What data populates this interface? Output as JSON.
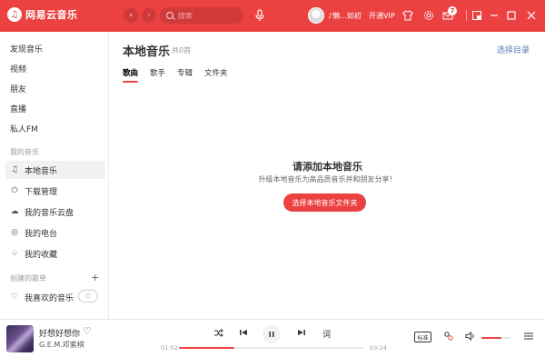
{
  "titlebar": {
    "app_name": "网易云音乐",
    "search_placeholder": "搜索",
    "username": "♪懒...如初",
    "vip_label": "开通VIP",
    "message_badge": "7"
  },
  "sidebar": {
    "top_items": [
      "发现音乐",
      "视频",
      "朋友",
      "直播",
      "私人FM"
    ],
    "my_music_header": "我的音乐",
    "my_music_items": [
      {
        "label": "本地音乐",
        "icon": "music-note-icon"
      },
      {
        "label": "下载管理",
        "icon": "download-icon"
      },
      {
        "label": "我的音乐云盘",
        "icon": "cloud-icon"
      },
      {
        "label": "我的电台",
        "icon": "radio-icon"
      },
      {
        "label": "我的收藏",
        "icon": "collection-icon"
      }
    ],
    "created_header": "创建的歌单",
    "playlists": [
      {
        "label": "我喜欢的音乐",
        "icon": "heart-icon"
      }
    ]
  },
  "main": {
    "title": "本地音乐",
    "count": "共0首",
    "select_dir_link": "选择目录",
    "tabs": [
      "歌曲",
      "歌手",
      "专辑",
      "文件夹"
    ],
    "active_tab": 0,
    "empty_title": "请添加本地音乐",
    "empty_subtitle": "升级本地音乐为高品质音乐并和朋友分享！",
    "empty_button": "选择本地音乐文件夹"
  },
  "player": {
    "song_title": "好想好想你",
    "artist": "G.E.M.邓紫棋",
    "current_time": "01:02",
    "total_time": "03:24",
    "progress_fraction": 0.3,
    "volume_fraction": 0.7,
    "lyrics_label": "词",
    "quality_label": "标准",
    "accent_color": "#ec4141"
  }
}
